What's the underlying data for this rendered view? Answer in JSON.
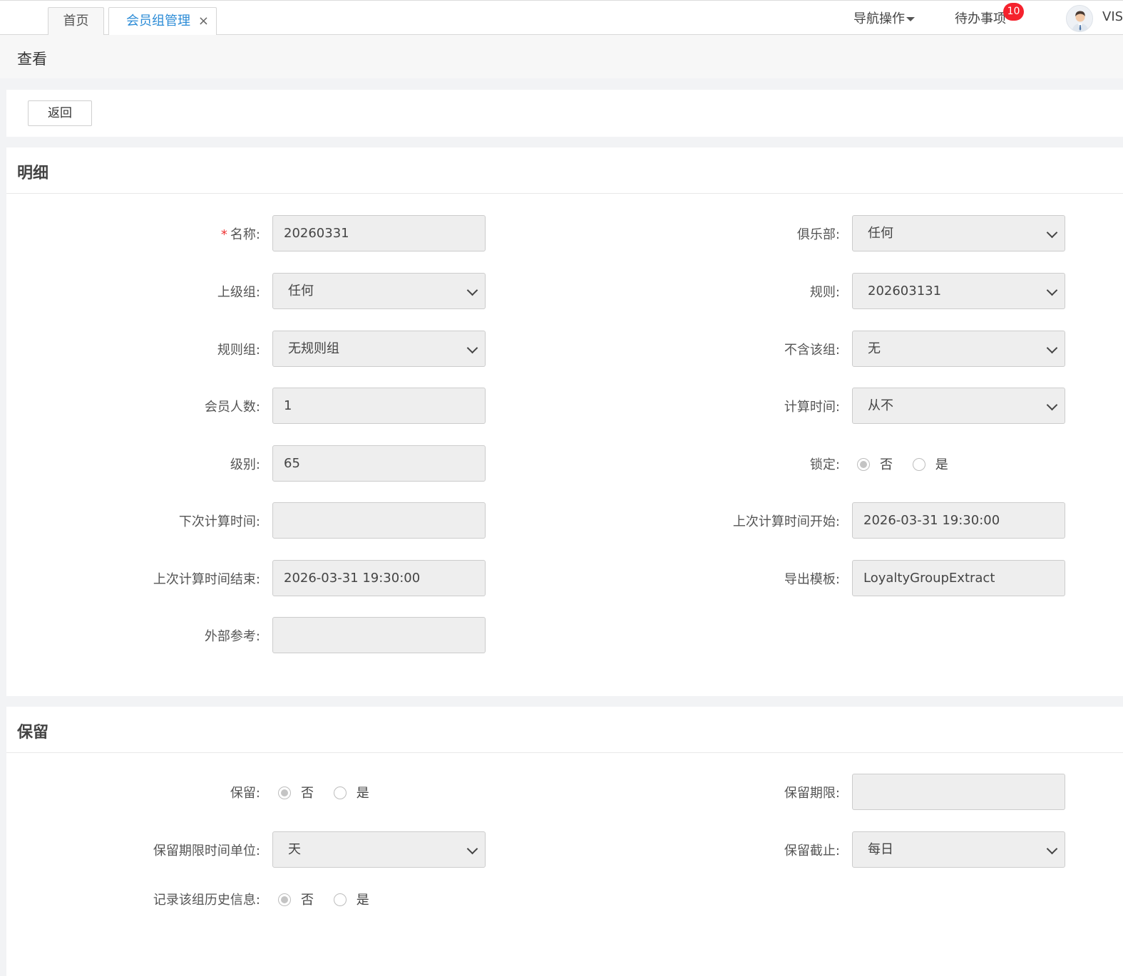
{
  "tabs": {
    "home": "首页",
    "active": "会员组管理",
    "close": "×"
  },
  "header": {
    "nav_ops": "导航操作",
    "todo": "待办事项",
    "todo_count": "10",
    "user": "VIS"
  },
  "page": {
    "title": "查看",
    "back_button": "返回"
  },
  "detail": {
    "title": "明细",
    "name_label": "名称:",
    "name_value": "20260331",
    "club_label": "俱乐部:",
    "club_value": "任何",
    "parent_label": "上级组:",
    "parent_value": "任何",
    "rule_label": "规则:",
    "rule_value": "202603131",
    "rulegroup_label": "规则组:",
    "rulegroup_value": "无规则组",
    "exclude_label": "不含该组:",
    "exclude_value": "无",
    "members_label": "会员人数:",
    "members_value": "1",
    "calc_time_label": "计算时间:",
    "calc_time_value": "从不",
    "level_label": "级别:",
    "level_value": "65",
    "lock_label": "锁定:",
    "next_calc_label": "下次计算时间:",
    "next_calc_value": "",
    "last_start_label": "上次计算时间开始:",
    "last_start_value": "2026-03-31 19:30:00",
    "last_end_label": "上次计算时间结束:",
    "last_end_value": "2026-03-31 19:30:00",
    "export_label": "导出模板:",
    "export_value": "LoyaltyGroupExtract",
    "external_label": "外部参考:",
    "external_value": ""
  },
  "radio": {
    "no": "否",
    "yes": "是"
  },
  "retain": {
    "title": "保留",
    "retain_label": "保留:",
    "period_label": "保留期限:",
    "period_value": "",
    "unit_label": "保留期限时间单位:",
    "unit_value": "天",
    "cutoff_label": "保留截止:",
    "cutoff_value": "每日",
    "history_label": "记录该组历史信息:"
  }
}
